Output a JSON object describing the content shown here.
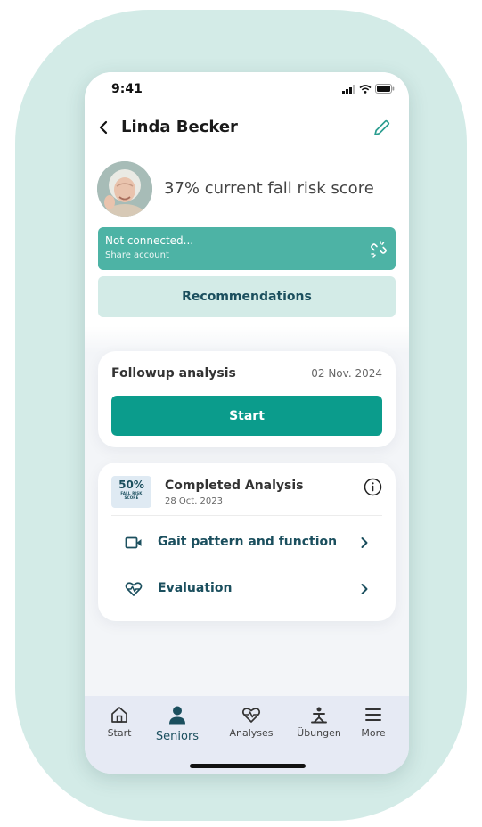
{
  "status_bar": {
    "time": "9:41"
  },
  "header": {
    "name": "Linda Becker"
  },
  "profile": {
    "risk_text": "37% current fall risk score"
  },
  "connection": {
    "title": "Not connected...",
    "subtitle": "Share account"
  },
  "recommendations_label": "Recommendations",
  "followup": {
    "title": "Followup analysis",
    "date": "02 Nov. 2024",
    "start_label": "Start"
  },
  "completed": {
    "badge_value": "50%",
    "badge_label_1": "FALL RISK",
    "badge_label_2": "SCORE",
    "title": "Completed Analysis",
    "date": "28 Oct. 2023",
    "items": [
      {
        "label": "Gait pattern and function",
        "icon": "video-camera-icon"
      },
      {
        "label": "Evaluation",
        "icon": "heart-pulse-icon"
      }
    ]
  },
  "tabbar": {
    "tabs": [
      {
        "label": "Start",
        "icon": "home-icon"
      },
      {
        "label": "Seniors",
        "icon": "person-icon",
        "active": true
      },
      {
        "label": "Analyses",
        "icon": "heart-pulse-icon"
      },
      {
        "label": "Übungen",
        "icon": "exercise-icon"
      },
      {
        "label": "More",
        "icon": "menu-icon"
      }
    ]
  },
  "colors": {
    "accent_teal": "#0b9c8c",
    "connect_bar": "#4db3a5",
    "soft_mint": "#d3ebe7",
    "dark_teal_text": "#1b4f5e",
    "tab_bar": "#e6eaf4"
  }
}
